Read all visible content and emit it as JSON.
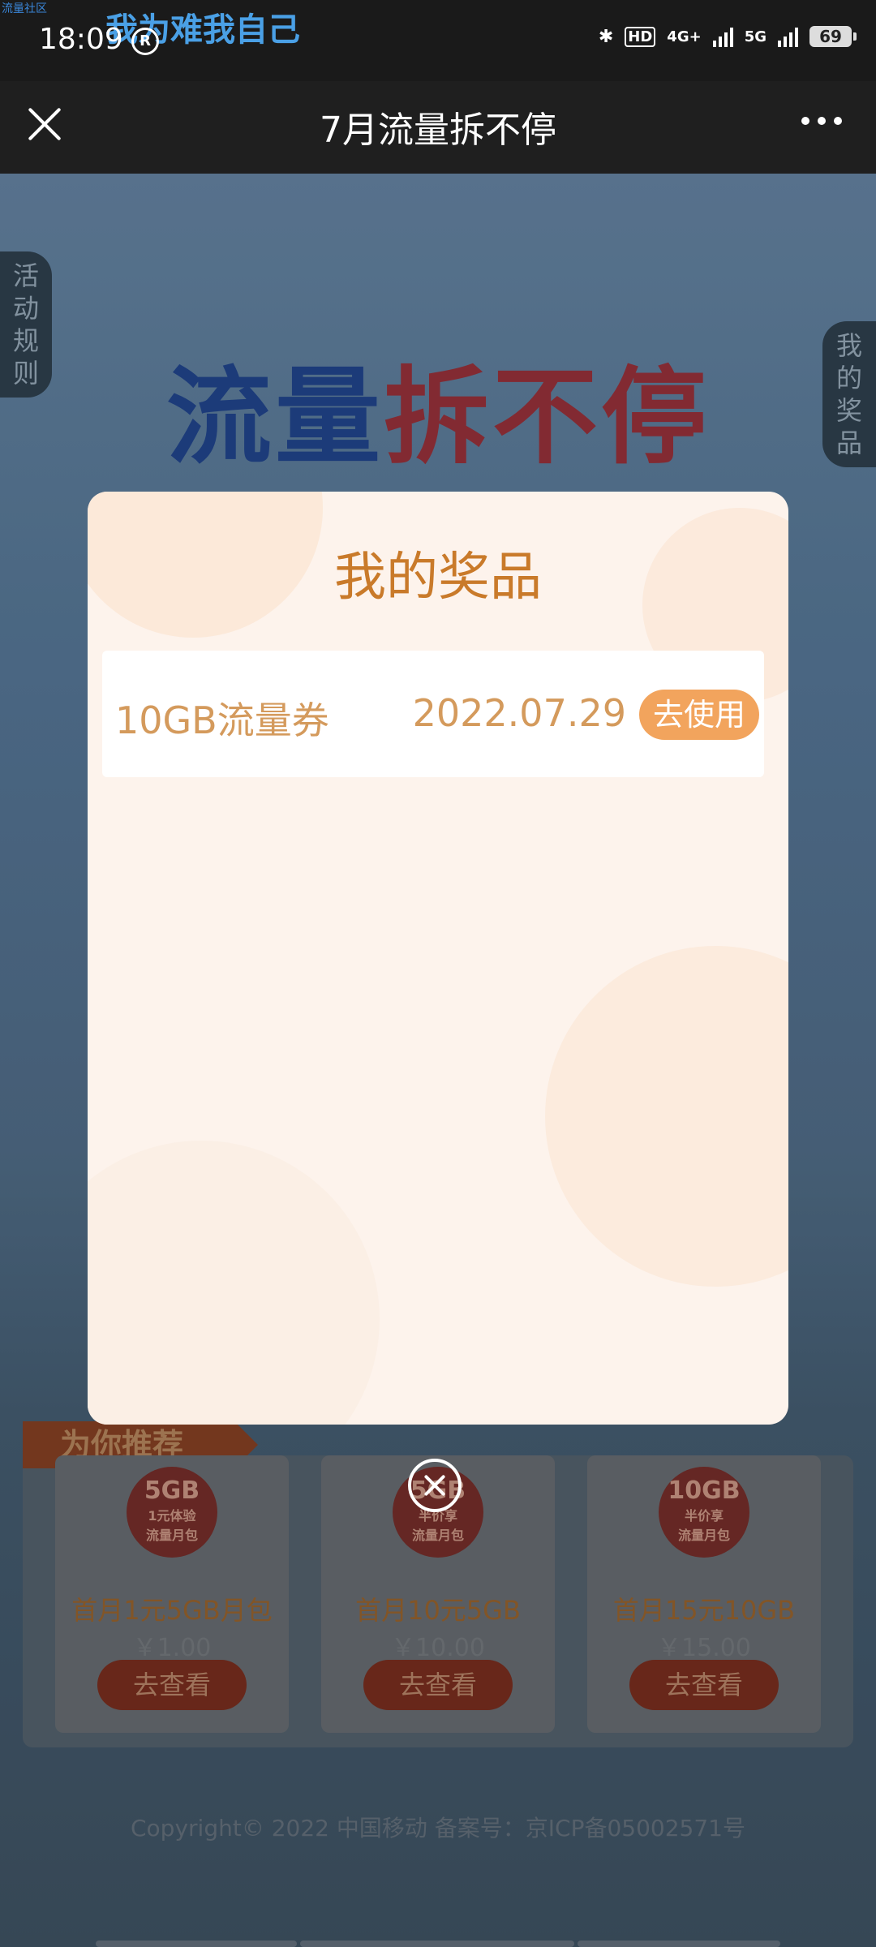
{
  "status_bar": {
    "watermark_small": "流量社区",
    "watermark_big": "我为难我自己",
    "time": "18:09",
    "time_icon": "R",
    "hd_label": "HD",
    "net1": "4G+",
    "net2": "5G",
    "battery": "69"
  },
  "titlebar": {
    "title": "7月流量拆不停"
  },
  "background": {
    "banner_part1": "流量",
    "banner_part2": "拆不停",
    "left_tab": [
      "活",
      "动",
      "规",
      "则"
    ],
    "right_tab": [
      "我",
      "的",
      "奖",
      "品"
    ],
    "recommend_header": "为你推荐",
    "cards": [
      {
        "badge_big": "5GB",
        "badge_small": "1元体验",
        "badge_sub": "流量月包",
        "name": "首月1元5GB月包",
        "price": "￥1.00",
        "btn": "去查看"
      },
      {
        "badge_big": "5GB",
        "badge_small": "半价享",
        "badge_sub": "流量月包",
        "name": "首月10元5GB",
        "price": "￥10.00",
        "btn": "去查看"
      },
      {
        "badge_big": "10GB",
        "badge_small": "半价享",
        "badge_sub": "流量月包",
        "name": "首月15元10GB",
        "price": "￥15.00",
        "btn": "去查看"
      }
    ],
    "copyright": "Copyright© 2022 中国移动 备案号：京ICP备05002571号"
  },
  "modal": {
    "title": "我的奖品",
    "prize": {
      "name": "10GB流量券",
      "date": "2022.07.29",
      "action": "去使用"
    }
  },
  "colors": {
    "modal_title": "#c97a2a",
    "prize_text": "#d49a5c",
    "prize_button": "#f2a45d"
  }
}
